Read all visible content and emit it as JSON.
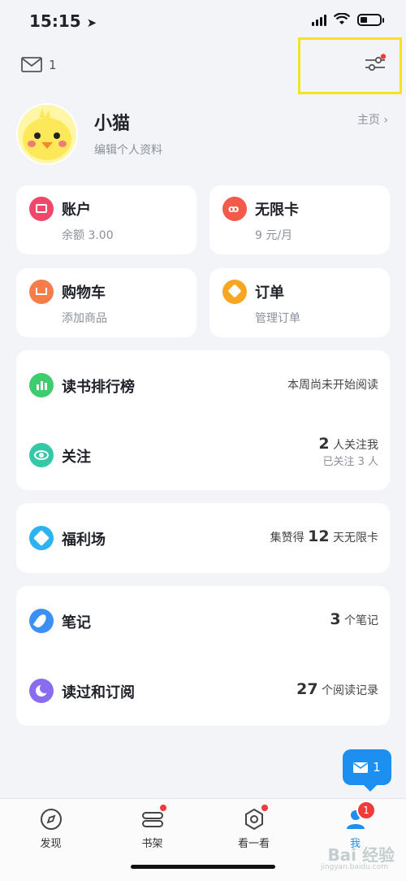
{
  "status": {
    "time": "15:15",
    "battery_level": 0.35
  },
  "header": {
    "mail_count": "1"
  },
  "profile": {
    "name": "小猫",
    "edit_label": "编辑个人资料",
    "homepage_label": "主页"
  },
  "tiles": [
    {
      "title": "账户",
      "sub": "余额 3.00",
      "icon": "wallet-icon",
      "color": "#f0476a"
    },
    {
      "title": "无限卡",
      "sub": "9 元/月",
      "icon": "infinite-card-icon",
      "color": "#f25a4a"
    },
    {
      "title": "购物车",
      "sub": "添加商品",
      "icon": "cart-icon",
      "color": "#f47d4a"
    },
    {
      "title": "订单",
      "sub": "管理订单",
      "icon": "order-icon",
      "color": "#f6a623"
    }
  ],
  "group1": {
    "ranking": {
      "title": "读书排行榜",
      "right": "本周尚未开始阅读"
    },
    "follow": {
      "title": "关注",
      "count": "2",
      "count_label": "人关注我",
      "sub": "已关注 3 人"
    }
  },
  "welfare": {
    "title": "福利场",
    "prefix": "集赞得",
    "count": "12",
    "suffix": "天无限卡"
  },
  "group2": {
    "notes": {
      "title": "笔记",
      "count": "3",
      "suffix": "个笔记"
    },
    "history": {
      "title": "读过和订阅",
      "count": "27",
      "suffix": "个阅读记录"
    }
  },
  "float_msg": {
    "count": "1"
  },
  "tabs": [
    {
      "label": "发现",
      "icon": "compass-icon"
    },
    {
      "label": "书架",
      "icon": "bookshelf-icon"
    },
    {
      "label": "看一看",
      "icon": "look-icon"
    },
    {
      "label": "我",
      "icon": "profile-icon",
      "badge": "1"
    }
  ],
  "watermark": {
    "text": "Bai 经验",
    "sub": "jingyan.baidu.com"
  },
  "colors": {
    "accent": "#1c8ff0",
    "highlight": "#f2e424",
    "badge": "#f23a3a"
  }
}
